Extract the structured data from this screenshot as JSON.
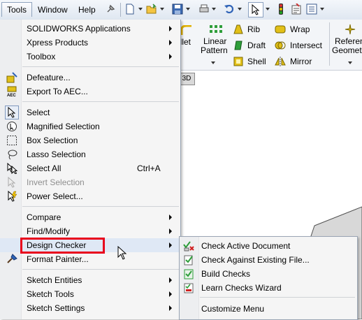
{
  "menubar": {
    "tools": "Tools",
    "window": "Window",
    "help": "Help"
  },
  "ribbon": {
    "fillet": "illet",
    "linear_pattern_1": "Linear",
    "linear_pattern_2": "Pattern",
    "rib": "Rib",
    "draft": "Draft",
    "shell": "Shell",
    "wrap": "Wrap",
    "intersect": "Intersect",
    "mirror": "Mirror",
    "reference_1": "Referen",
    "reference_2": "Geomet",
    "tab_3d": "3D"
  },
  "menu": {
    "items": [
      {
        "label": "SOLIDWORKS Applications",
        "submenu": true
      },
      {
        "label": "Xpress Products",
        "submenu": true
      },
      {
        "label": "Toolbox",
        "submenu": true
      },
      {
        "label": "Defeature...",
        "icon": "defeature-icon"
      },
      {
        "label": "Export To AEC...",
        "icon": "aec-icon"
      },
      {
        "label": "Select",
        "icon": "select-arrow-icon"
      },
      {
        "label": "Magnified Selection",
        "icon": "magnified-selection-icon"
      },
      {
        "label": "Box Selection",
        "icon": "box-selection-icon"
      },
      {
        "label": "Lasso Selection",
        "icon": "lasso-icon"
      },
      {
        "label": "Select All",
        "shortcut": "Ctrl+A",
        "icon": "select-all-icon"
      },
      {
        "label": "Invert Selection",
        "disabled": true,
        "icon": "invert-selection-icon"
      },
      {
        "label": "Power Select...",
        "icon": "power-select-icon"
      },
      {
        "label": "Compare",
        "submenu": true
      },
      {
        "label": "Find/Modify",
        "submenu": true
      },
      {
        "label": "Design Checker",
        "submenu": true
      },
      {
        "label": "Format Painter...",
        "icon": "format-painter-icon"
      },
      {
        "label": "Sketch Entities",
        "submenu": true
      },
      {
        "label": "Sketch Tools",
        "submenu": true
      },
      {
        "label": "Sketch Settings",
        "submenu": true
      }
    ]
  },
  "submenu": {
    "items": [
      {
        "label": "Check Active Document",
        "icon": "check-active-document-icon"
      },
      {
        "label": "Check Against Existing File...",
        "icon": "check-existing-file-icon"
      },
      {
        "label": "Build Checks",
        "icon": "build-checks-icon"
      },
      {
        "label": "Learn Checks Wizard",
        "icon": "learn-checks-wizard-icon"
      },
      {
        "label": "Customize Menu"
      }
    ]
  },
  "colors": {
    "highlight_border": "#e8001c",
    "hover_bg": "#dfe8f5"
  }
}
